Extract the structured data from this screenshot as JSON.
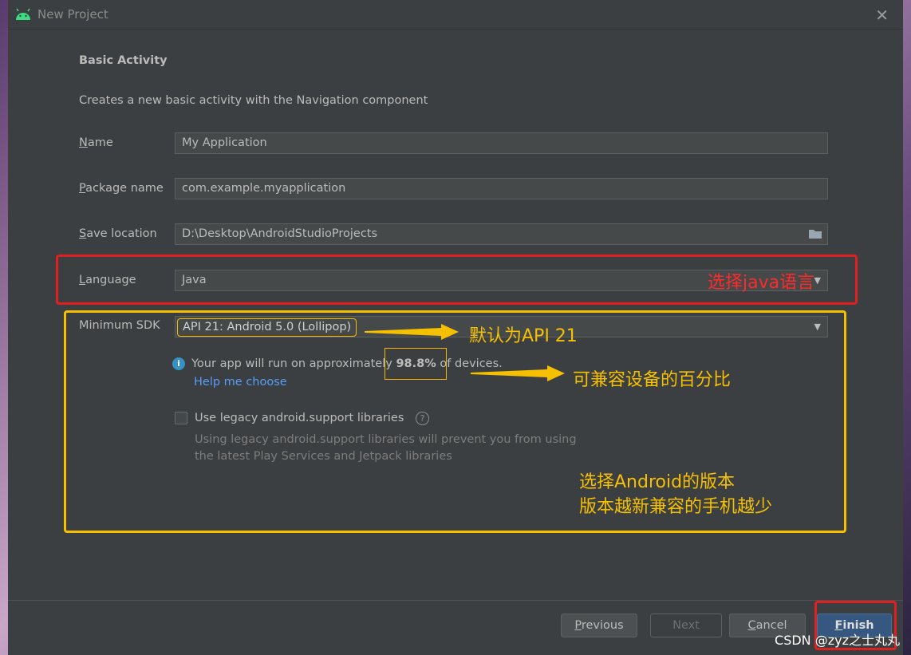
{
  "window": {
    "title": "New Project"
  },
  "form": {
    "heading": "Basic Activity",
    "description": "Creates a new basic activity with the Navigation component",
    "name": {
      "label_accel": "N",
      "label_rest": "ame",
      "value": "My Application"
    },
    "package": {
      "label_accel": "P",
      "label_rest": "ackage name",
      "value": "com.example.myapplication"
    },
    "save_location": {
      "label_accel": "S",
      "label_rest": "ave location",
      "value": "D:\\Desktop\\AndroidStudioProjects"
    },
    "language": {
      "label_accel": "L",
      "label_rest": "anguage",
      "value": "Java"
    },
    "min_sdk": {
      "label": "Minimum SDK",
      "value": "API 21: Android 5.0 (Lollipop)"
    },
    "info": {
      "prefix": "Your app will run on approximately ",
      "percent": "98.8%",
      "suffix": " of devices."
    },
    "help_link": "Help me choose",
    "legacy": {
      "label": "Use legacy android.support libraries",
      "checked": false,
      "note_line1": "Using legacy android.support libraries will prevent you from using",
      "note_line2": "the latest Play Services and Jetpack libraries"
    }
  },
  "buttons": {
    "previous": {
      "accel": "P",
      "rest": "revious"
    },
    "next": "Next",
    "cancel": {
      "accel": "C",
      "rest": "ancel"
    },
    "finish": {
      "accel": "F",
      "rest": "inish"
    }
  },
  "annotations": {
    "language_note": "选择java语言",
    "sdk_default_note": "默认为API 21",
    "percent_note": "可兼容设备的百分比",
    "version_note_line1": "选择Android的版本",
    "version_note_line2": "版本越新兼容的手机越少",
    "red_color": "#e02020",
    "yellow_color": "#f6c000"
  },
  "watermark": "CSDN @zyz之士丸丸"
}
